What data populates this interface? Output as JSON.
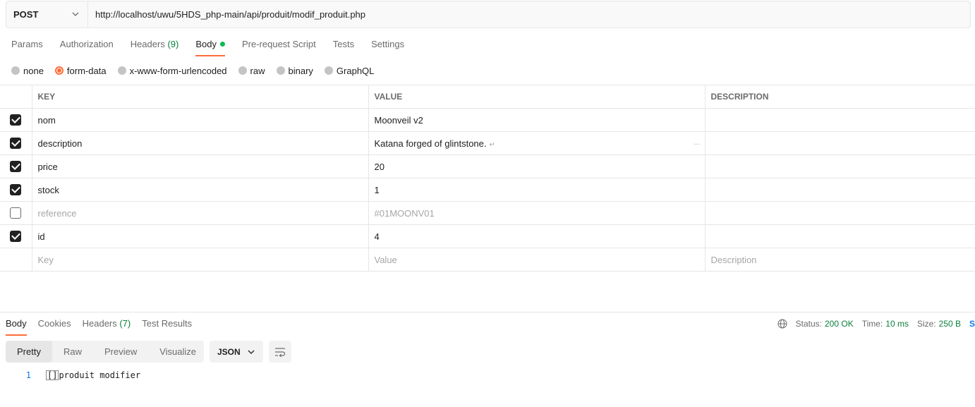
{
  "request": {
    "method": "POST",
    "url": "http://localhost/uwu/5HDS_php-main/api/produit/modif_produit.php"
  },
  "request_tabs": [
    {
      "label": "Params",
      "count": ""
    },
    {
      "label": "Authorization",
      "count": ""
    },
    {
      "label": "Headers",
      "count": "(9)"
    },
    {
      "label": "Body",
      "count": "",
      "active": true
    },
    {
      "label": "Pre-request Script",
      "count": ""
    },
    {
      "label": "Tests",
      "count": ""
    },
    {
      "label": "Settings",
      "count": ""
    }
  ],
  "body_types": [
    {
      "label": "none",
      "selected": false
    },
    {
      "label": "form-data",
      "selected": true
    },
    {
      "label": "x-www-form-urlencoded",
      "selected": false
    },
    {
      "label": "raw",
      "selected": false
    },
    {
      "label": "binary",
      "selected": false
    },
    {
      "label": "GraphQL",
      "selected": false
    }
  ],
  "table": {
    "headers": [
      "KEY",
      "VALUE",
      "DESCRIPTION"
    ],
    "rows": [
      {
        "checked": true,
        "key": "nom",
        "value": "Moonveil v2",
        "description": ""
      },
      {
        "checked": true,
        "key": "description",
        "value": "Katana forged of glintstone.",
        "description": ""
      },
      {
        "checked": true,
        "key": "price",
        "value": "20",
        "description": ""
      },
      {
        "checked": true,
        "key": "stock",
        "value": "1",
        "description": ""
      },
      {
        "checked": false,
        "key": "reference",
        "value": "#01MOONV01",
        "description": ""
      },
      {
        "checked": true,
        "key": "id",
        "value": "4",
        "description": ""
      }
    ],
    "placeholders": {
      "key": "Key",
      "value": "Value",
      "description": "Description"
    },
    "more": "..."
  },
  "response": {
    "tabs": [
      {
        "label": "Body",
        "count": "",
        "active": true
      },
      {
        "label": "Cookies",
        "count": ""
      },
      {
        "label": "Headers",
        "count": "(7)"
      },
      {
        "label": "Test Results",
        "count": ""
      }
    ],
    "status_label": "Status:",
    "status_value": "200 OK",
    "time_label": "Time:",
    "time_value": "10 ms",
    "size_label": "Size:",
    "size_value": "250 B",
    "save_label": "Save Response",
    "views": [
      "Pretty",
      "Raw",
      "Preview",
      "Visualize"
    ],
    "active_view": "Pretty",
    "format": "JSON",
    "lines": [
      {
        "no": "1",
        "bracket": "[]",
        "text": "produit modifier"
      }
    ]
  },
  "colors": {
    "accent": "#ff6c37",
    "success": "#0a7f3b",
    "link": "#097bed"
  }
}
